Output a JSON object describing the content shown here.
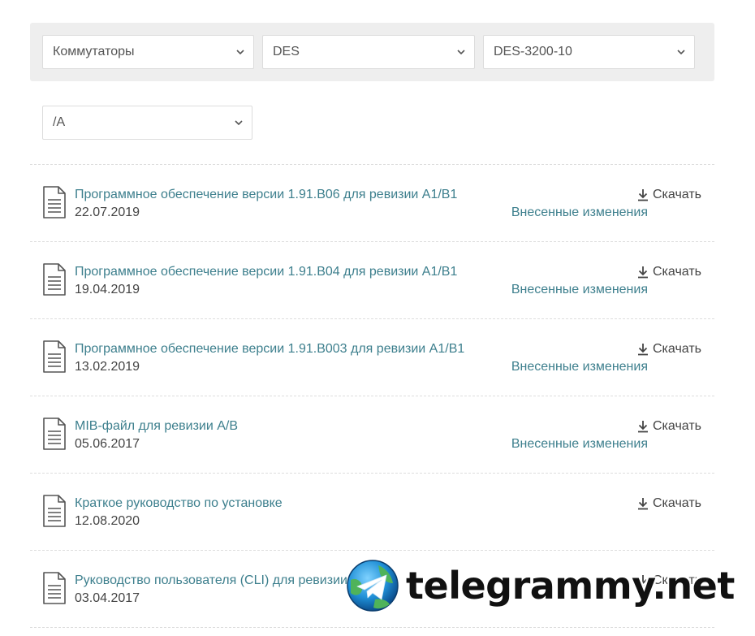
{
  "filters": {
    "category": "Коммутаторы",
    "series": "DES",
    "model": "DES-3200-10",
    "revision": "/A"
  },
  "files": [
    {
      "title": "Программное обеспечение версии 1.91.B06 для ревизии A1/B1",
      "date": "22.07.2019",
      "download": "Скачать",
      "changes": "Внесенные изменения"
    },
    {
      "title": "Программное обеспечение версии 1.91.B04 для ревизии A1/B1",
      "date": "19.04.2019",
      "download": "Скачать",
      "changes": "Внесенные изменения"
    },
    {
      "title": "Программное обеспечение версии 1.91.B003 для ревизии A1/B1",
      "date": "13.02.2019",
      "download": "Скачать",
      "changes": "Внесенные изменения"
    },
    {
      "title": "MIB-файл для ревизии A/B",
      "date": "05.06.2017",
      "download": "Скачать",
      "changes": "Внесенные изменения"
    },
    {
      "title": "Краткое руководство по установке",
      "date": "12.08.2020",
      "download": "Скачать"
    },
    {
      "title": "Руководство пользователя (CLI) для ревизии",
      "date": "03.04.2017",
      "download": "Скачать"
    }
  ],
  "watermark": {
    "text": "telegrammy.net"
  },
  "icons": {
    "chevron": "chevron-down-icon",
    "document": "document-icon",
    "download": "download-icon",
    "logo": "telegram-logo-icon"
  },
  "colors": {
    "link": "#3d7f8d",
    "text": "#444444",
    "filter_bar_bg": "#eeeeee"
  }
}
